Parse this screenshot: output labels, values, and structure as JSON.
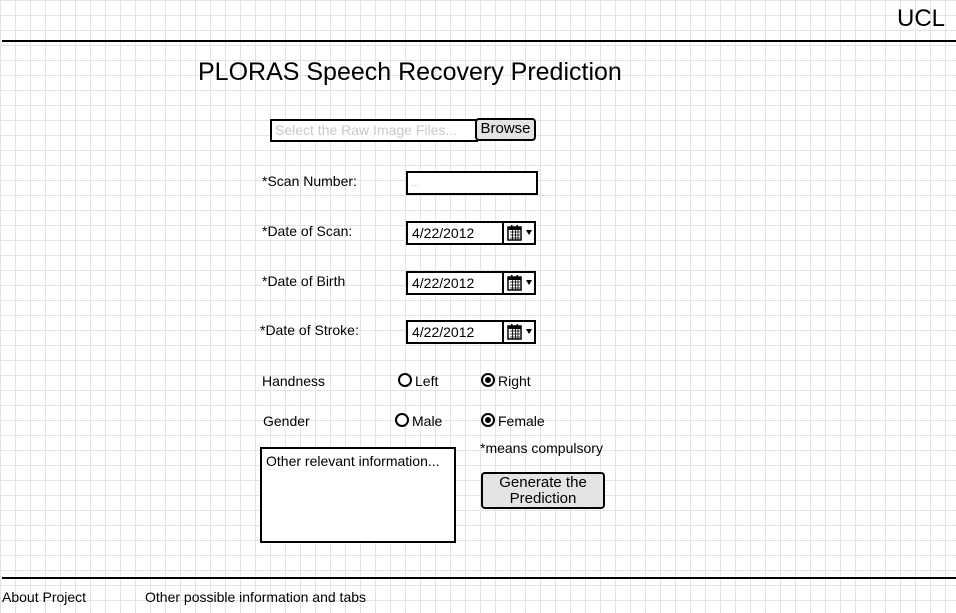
{
  "header": {
    "brand": "UCL",
    "title": "PLORAS Speech Recovery Prediction"
  },
  "file_upload": {
    "placeholder": "Select the Raw Image Files...",
    "browse_label": "Browse"
  },
  "form": {
    "scan_number": {
      "label": "*Scan Number:",
      "placeholder": "..."
    },
    "date_of_scan": {
      "label": "*Date of Scan:",
      "value": "4/22/2012"
    },
    "date_of_birth": {
      "label": "*Date of Birth",
      "value": "4/22/2012"
    },
    "date_of_stroke": {
      "label": "*Date of Stroke:",
      "value": "4/22/2012"
    },
    "handness": {
      "label": "Handness",
      "options": [
        "Left",
        "Right"
      ],
      "selected": "Right"
    },
    "gender": {
      "label": "Gender",
      "options": [
        "Male",
        "Female"
      ],
      "selected": "Female"
    },
    "compulsory_note": "*means compulsory",
    "other_info_placeholder": "Other relevant information...",
    "generate_label": "Generate the Prediction"
  },
  "footer": {
    "links": [
      "About Project",
      "Other possible information and tabs"
    ]
  },
  "icons": {
    "date_picker": "calendar-icon"
  }
}
